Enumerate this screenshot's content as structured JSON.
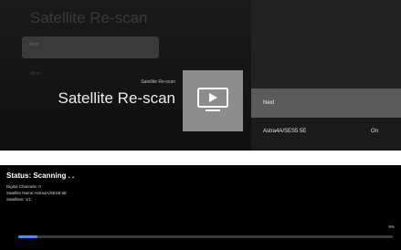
{
  "top_screen": {
    "background": {
      "title": "Satellite Re-scan",
      "next_label": "Next",
      "more_label": "More"
    },
    "subtitle_small": "Satellite Re-scan",
    "title": "Satellite Re-scan",
    "tile_icon": "tv-play-icon",
    "menu": {
      "items": [
        {
          "label": "Next",
          "selected": true
        },
        {
          "label": "Astra4A/SES5 5E",
          "value": "On"
        }
      ]
    }
  },
  "bottom_screen": {
    "status_title": "Status: Scanning . .",
    "lines": [
      "Digital Channels:  0",
      "Satellite Name:Astra4A/SES5 5E",
      "Satellites:  1/1"
    ],
    "progress": {
      "label": "5%",
      "fraction": 0.05
    }
  },
  "colors": {
    "accent": "#4f8ee8",
    "tile": "#8d8d8d",
    "selected_row": "#5b5b5b"
  }
}
